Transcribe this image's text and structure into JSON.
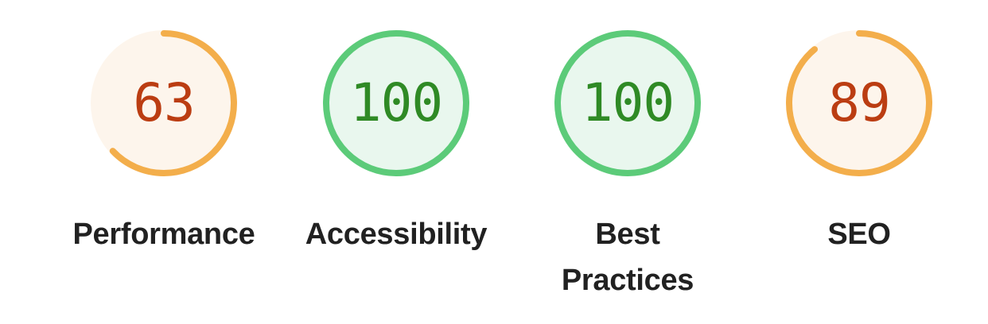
{
  "colors": {
    "average_arc": "#f3ae4b",
    "average_fill": "#fdf5ec",
    "average_text": "#bb3d12",
    "pass_arc": "#5ccb79",
    "pass_fill": "#e9f7ee",
    "pass_text": "#2f8a25",
    "label_text": "#212121"
  },
  "gauges": [
    {
      "score": "63",
      "value": 63,
      "label": "Performance",
      "rating": "average"
    },
    {
      "score": "100",
      "value": 100,
      "label": "Accessibility",
      "rating": "pass"
    },
    {
      "score": "100",
      "value": 100,
      "label": "Best Practices",
      "rating": "pass"
    },
    {
      "score": "89",
      "value": 89,
      "label": "SEO",
      "rating": "average"
    }
  ]
}
